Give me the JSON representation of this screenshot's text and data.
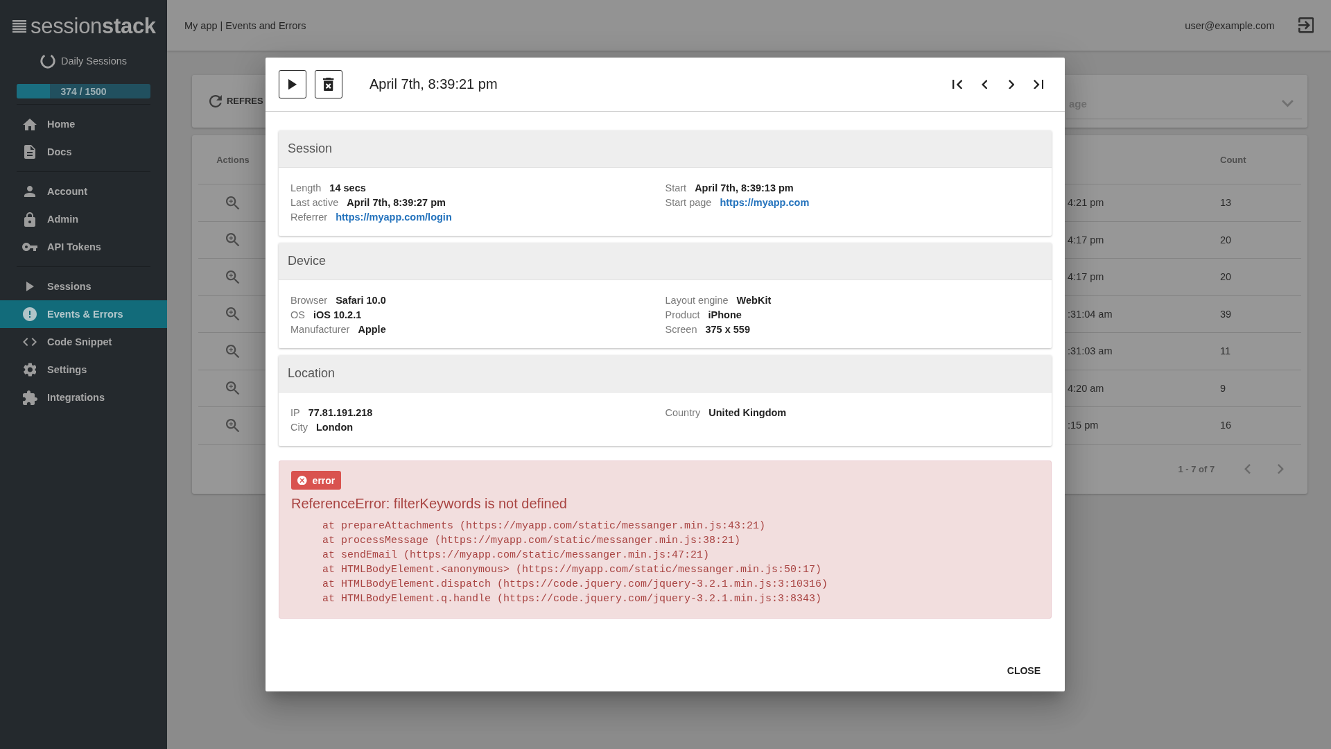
{
  "sidebar": {
    "logo": "session**stack**",
    "daily_sessions": {
      "label": "Daily Sessions",
      "level": 0.25,
      "reading": "374 / 1500"
    },
    "groups": [
      {
        "items": [
          {
            "label": "Home",
            "selected": false
          },
          {
            "label": "Docs",
            "selected": false
          }
        ]
      },
      {
        "items": [
          {
            "label": "Account",
            "selected": false
          },
          {
            "label": "Admin",
            "selected": false
          },
          {
            "label": "API Tokens",
            "selected": false
          }
        ]
      },
      {
        "items": [
          {
            "label": "Sessions",
            "selected": false
          },
          {
            "label": "Events & Errors",
            "selected": true
          },
          {
            "label": "Code Snippet",
            "selected": false
          },
          {
            "label": "Settings",
            "selected": false
          },
          {
            "label": "Integrations",
            "selected": false
          }
        ]
      }
    ]
  },
  "topbar": {
    "breadcrumb": "My app | Events and Errors",
    "user": "user@example.com"
  },
  "events_page": {
    "refresh_button": "REFRES",
    "filter_dropdown": {
      "label": "age"
    },
    "table": {
      "columns": [
        "Actions",
        "Count"
      ],
      "rows": [
        {
          "column_2": "4:21 pm",
          "count": "13"
        },
        {
          "column_2": "4:17 pm",
          "count": "20"
        },
        {
          "column_2": "4:17 pm",
          "count": "20"
        },
        {
          "column_2": ":31:04 am",
          "count": "39"
        },
        {
          "column_2": ":31:03 am",
          "count": "11"
        },
        {
          "column_2": "4:20 am",
          "count": "9"
        },
        {
          "column_2": ":15 pm",
          "count": "16"
        }
      ]
    },
    "pagination": {
      "range": "1 - 7 of 7"
    }
  },
  "modal": {
    "title": "April 7th, 8:39:21 pm",
    "sections": [
      {
        "title": "Session",
        "columns": [
          [
            {
              "label": "Length",
              "value": "14 secs",
              "kind": "text"
            },
            {
              "label": "Last active",
              "value": "April 7th, 8:39:27 pm",
              "kind": "text"
            },
            {
              "label": "Referrer",
              "value": "https://myapp.com/login",
              "kind": "link"
            }
          ],
          [
            {
              "label": "Start",
              "value": "April 7th, 8:39:13 pm",
              "kind": "text"
            },
            {
              "label": "Start page",
              "value": "https://myapp.com",
              "kind": "link"
            }
          ]
        ]
      },
      {
        "title": "Device",
        "columns": [
          [
            {
              "label": "Browser",
              "value": "Safari 10.0",
              "kind": "text"
            },
            {
              "label": "OS",
              "value": "iOS 10.2.1",
              "kind": "text"
            },
            {
              "label": "Manufacturer",
              "value": "Apple",
              "kind": "text"
            }
          ],
          [
            {
              "label": "Layout engine",
              "value": "WebKit",
              "kind": "text"
            },
            {
              "label": "Product",
              "value": "iPhone",
              "kind": "text"
            },
            {
              "label": "Screen",
              "value": "375 x 559",
              "kind": "text"
            }
          ]
        ]
      },
      {
        "title": "Location",
        "columns": [
          [
            {
              "label": "IP",
              "value": "77.81.191.218",
              "kind": "text"
            },
            {
              "label": "City",
              "value": "London",
              "kind": "text"
            }
          ],
          [
            {
              "label": "Country",
              "value": "United Kingdom",
              "kind": "text"
            }
          ]
        ]
      }
    ],
    "error": {
      "badge": "error",
      "message": "ReferenceError: filterKeywords is not defined",
      "stack": [
        "at prepareAttachments (https://myapp.com/static/messanger.min.js:43:21)",
        "at processMessage (https://myapp.com/static/messanger.min.js:38:21)",
        "at sendEmail (https://myapp.com/static/messanger.min.js:47:21)",
        "at HTMLBodyElement.<anonymous> (https://myapp.com/static/messanger.min.js:50:17)",
        "at HTMLBodyElement.dispatch (https://code.jquery.com/jquery-3.2.1.min.js:3:10316)",
        "at HTMLBodyElement.q.handle (https://code.jquery.com/jquery-3.2.1.min.js:3:8343)"
      ]
    },
    "close_button": "CLOSE"
  }
}
